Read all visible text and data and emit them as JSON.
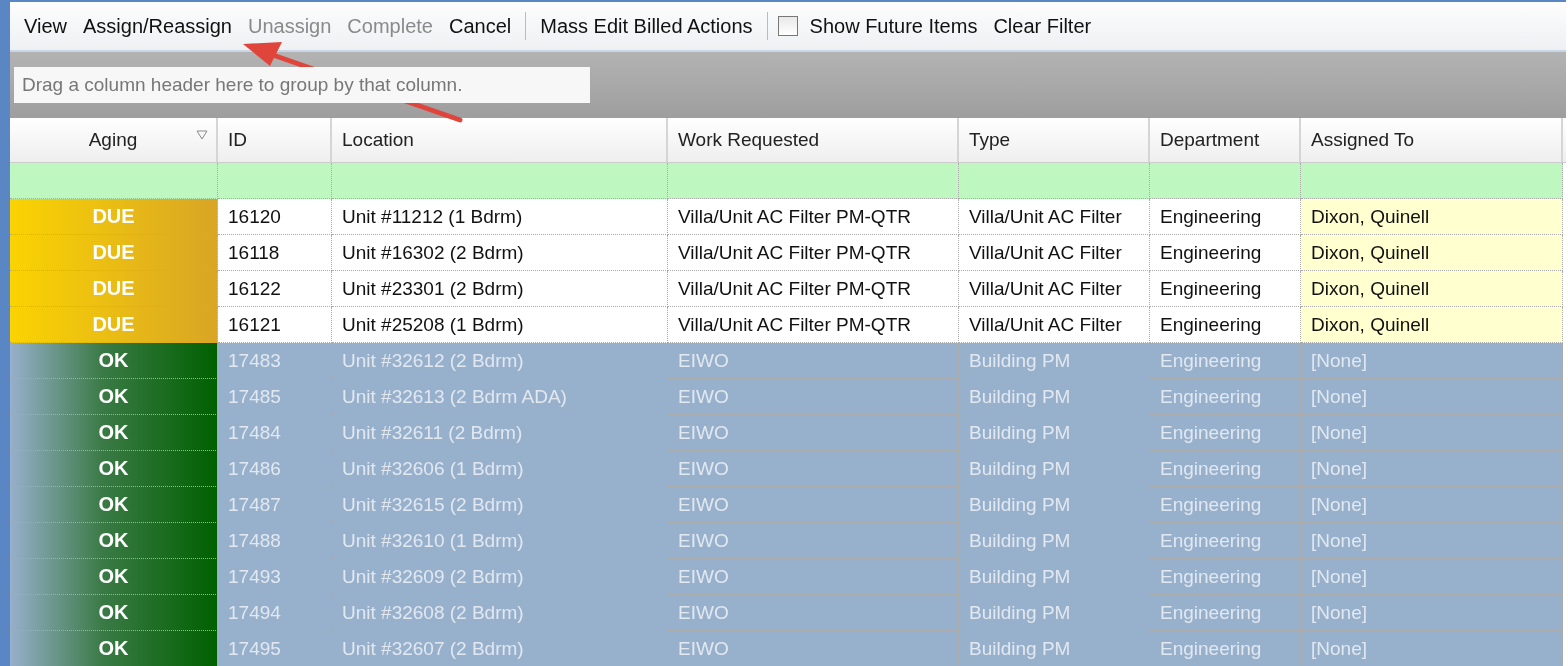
{
  "toolbar": [
    {
      "kind": "button",
      "label": "View",
      "disabled": false
    },
    {
      "kind": "button",
      "label": "Assign/Reassign",
      "disabled": false
    },
    {
      "kind": "button",
      "label": "Unassign",
      "disabled": true
    },
    {
      "kind": "button",
      "label": "Complete",
      "disabled": true
    },
    {
      "kind": "button",
      "label": "Cancel",
      "disabled": false
    },
    {
      "kind": "separator"
    },
    {
      "kind": "button",
      "label": "Mass Edit Billed Actions",
      "disabled": false
    },
    {
      "kind": "separator"
    },
    {
      "kind": "checkbox",
      "label": "Show Future Items",
      "checked": false
    },
    {
      "kind": "button",
      "label": "Clear Filter",
      "disabled": false
    }
  ],
  "group_panel": {
    "placeholder": "Drag a column header here to group by that column."
  },
  "table": {
    "columns": [
      {
        "label": "Aging",
        "filter": true
      },
      {
        "label": "ID",
        "filter": false
      },
      {
        "label": "Location",
        "filter": false
      },
      {
        "label": "Work Requested",
        "filter": false
      },
      {
        "label": "Type",
        "filter": false
      },
      {
        "label": "Department",
        "filter": false
      },
      {
        "label": "Assigned To",
        "filter": false
      }
    ],
    "rows": [
      {
        "kind": "due",
        "cells": [
          "DUE",
          "16120",
          "Unit #11212 (1 Bdrm)",
          "Villa/Unit AC Filter PM-QTR",
          "Villa/Unit AC Filter",
          "Engineering",
          "Dixon, Quinell"
        ]
      },
      {
        "kind": "due",
        "cells": [
          "DUE",
          "16118",
          "Unit #16302 (2 Bdrm)",
          "Villa/Unit AC Filter PM-QTR",
          "Villa/Unit AC Filter",
          "Engineering",
          "Dixon, Quinell"
        ]
      },
      {
        "kind": "due",
        "cells": [
          "DUE",
          "16122",
          "Unit #23301 (2 Bdrm)",
          "Villa/Unit AC Filter PM-QTR",
          "Villa/Unit AC Filter",
          "Engineering",
          "Dixon, Quinell"
        ]
      },
      {
        "kind": "due",
        "cells": [
          "DUE",
          "16121",
          "Unit #25208 (1 Bdrm)",
          "Villa/Unit AC Filter PM-QTR",
          "Villa/Unit AC Filter",
          "Engineering",
          "Dixon, Quinell"
        ]
      },
      {
        "kind": "ok",
        "cells": [
          "OK",
          "17483",
          "Unit #32612 (2 Bdrm)",
          "EIWO",
          "Building PM",
          "Engineering",
          "[None]"
        ]
      },
      {
        "kind": "ok",
        "cells": [
          "OK",
          "17485",
          "Unit #32613 (2 Bdrm ADA)",
          "EIWO",
          "Building PM",
          "Engineering",
          "[None]"
        ]
      },
      {
        "kind": "ok",
        "cells": [
          "OK",
          "17484",
          "Unit #32611 (2 Bdrm)",
          "EIWO",
          "Building PM",
          "Engineering",
          "[None]"
        ]
      },
      {
        "kind": "ok",
        "cells": [
          "OK",
          "17486",
          "Unit #32606 (1 Bdrm)",
          "EIWO",
          "Building PM",
          "Engineering",
          "[None]"
        ]
      },
      {
        "kind": "ok",
        "cells": [
          "OK",
          "17487",
          "Unit #32615 (2 Bdrm)",
          "EIWO",
          "Building PM",
          "Engineering",
          "[None]"
        ]
      },
      {
        "kind": "ok",
        "cells": [
          "OK",
          "17488",
          "Unit #32610 (1 Bdrm)",
          "EIWO",
          "Building PM",
          "Engineering",
          "[None]"
        ]
      },
      {
        "kind": "ok",
        "cells": [
          "OK",
          "17493",
          "Unit #32609 (2 Bdrm)",
          "EIWO",
          "Building PM",
          "Engineering",
          "[None]"
        ]
      },
      {
        "kind": "ok",
        "cells": [
          "OK",
          "17494",
          "Unit #32608 (2 Bdrm)",
          "EIWO",
          "Building PM",
          "Engineering",
          "[None]"
        ]
      },
      {
        "kind": "ok",
        "cells": [
          "OK",
          "17495",
          "Unit #32607 (2 Bdrm)",
          "EIWO",
          "Building PM",
          "Engineering",
          "[None]"
        ]
      }
    ]
  }
}
